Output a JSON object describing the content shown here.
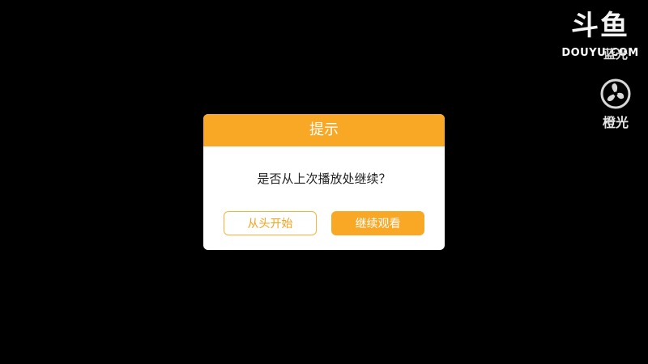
{
  "brand": {
    "logo_mark": "斗鱼",
    "logo_text": "DOUYU.COM"
  },
  "side_controls": {
    "quality_label": "蓝光",
    "light_label": "橙光",
    "light_icon": "fan-icon"
  },
  "dialog": {
    "title": "提示",
    "message": "是否从上次播放处继续？",
    "restart_label": "从头开始",
    "continue_label": "继续观看"
  },
  "colors": {
    "accent": "#f9a825",
    "background": "#000000"
  }
}
